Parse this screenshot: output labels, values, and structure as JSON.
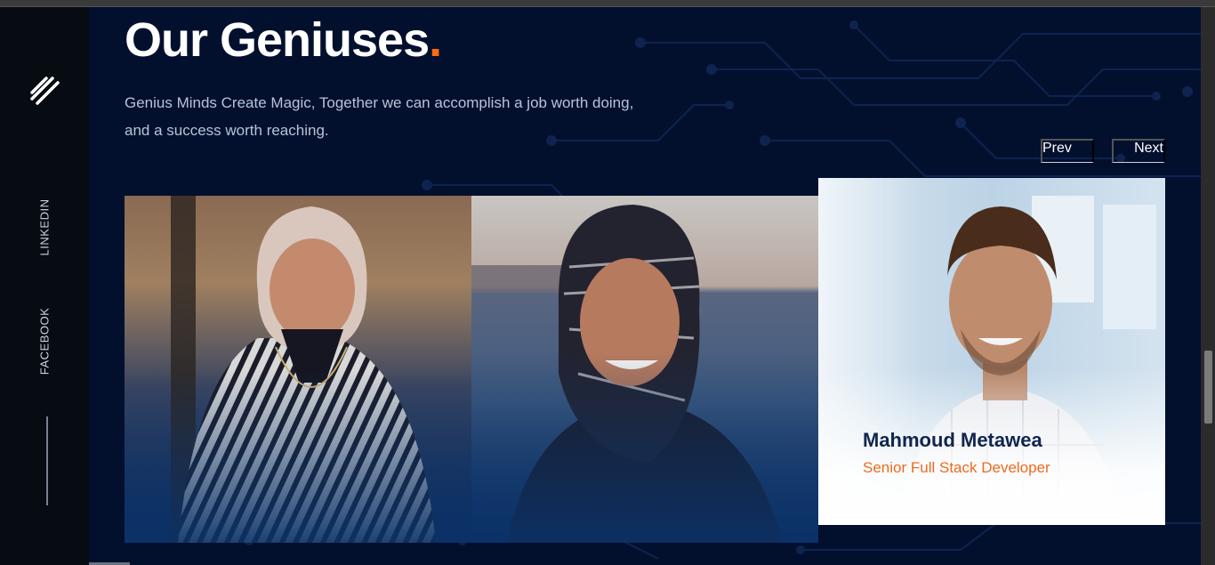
{
  "section": {
    "title": "Our Geniuses",
    "title_dot": ".",
    "subtitle": "Genius Minds Create Magic, Together we can accomplish a job worth doing, and a success worth reaching."
  },
  "social": {
    "linkedin": "LINKEDIN",
    "facebook": "FACEBOOK"
  },
  "carousel": {
    "prev_label": "Prev",
    "next_label": "Next",
    "active_member": {
      "name": "Mahmoud Metawea",
      "role": "Senior Full Stack Developer"
    }
  },
  "colors": {
    "background": "#02102e",
    "accent": "#ff6a13",
    "name": "#10254f"
  },
  "icons": {
    "logo": "three-slash-lines-icon"
  }
}
